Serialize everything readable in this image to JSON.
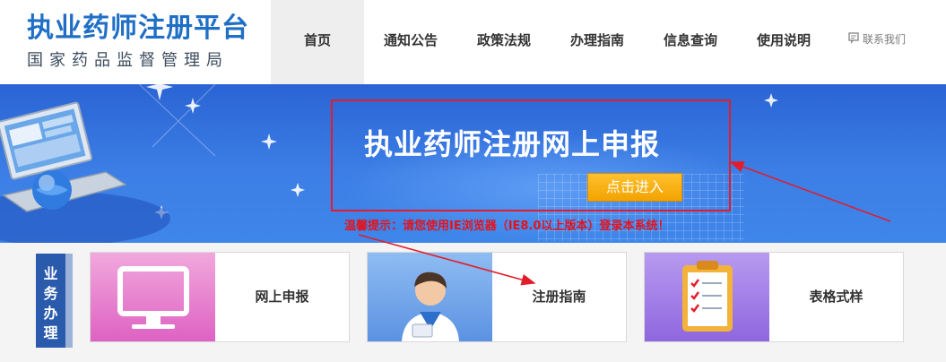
{
  "header": {
    "logo_title": "执业药师注册平台",
    "logo_subtitle": "国家药品监督管理局",
    "nav": [
      "首页",
      "通知公告",
      "政策法规",
      "办理指南",
      "信息查询",
      "使用说明"
    ],
    "active_index": 0,
    "contact_label": "联系我们"
  },
  "banner": {
    "title": "执业药师注册网上申报",
    "enter_label": "点击进入",
    "tip": "温馨提示：请您使用IE浏览器（IE8.0以上版本）登录本系统！"
  },
  "business": {
    "label_chars": [
      "业",
      "务",
      "办",
      "理"
    ],
    "cards": [
      {
        "label": "网上申报",
        "icon": "monitor-icon",
        "color": "#e87fce"
      },
      {
        "label": "注册指南",
        "icon": "user-guide-icon",
        "color": "#6ea3e9"
      },
      {
        "label": "表格式样",
        "icon": "clipboard-checklist-icon",
        "color": "#a37ee8"
      }
    ]
  },
  "colors": {
    "brand_blue": "#1f6fc6",
    "banner_blue": "#3c7ee5",
    "alert_red": "#e21d2b",
    "button_orange": "#f2a300",
    "label_blue": "#2a5aab"
  }
}
